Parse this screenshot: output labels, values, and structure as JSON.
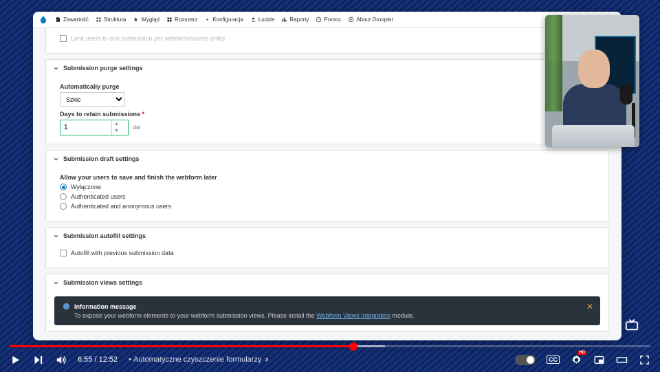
{
  "toolbar": {
    "items": [
      "Zawartość",
      "Struktura",
      "Wygląd",
      "Rozszerz",
      "Konfiguracja",
      "Ludzie",
      "Raporty",
      "Pomoc",
      "About Droopler"
    ]
  },
  "purge": {
    "heading": "Submission purge settings",
    "auto_label": "Automatically purge",
    "auto_value": "Szkic",
    "days_label": "Days to retain submissions",
    "days_value": "1",
    "days_suffix": "dni"
  },
  "draft": {
    "heading": "Submission draft settings",
    "allow_label": "Allow your users to save and finish the webform later",
    "options": [
      "Wyłączone",
      "Authenticated users",
      "Authenticated and anonymous users"
    ],
    "selected": 0
  },
  "autofill": {
    "heading": "Submission autofill settings",
    "check_label": "Autofill with previous submission data"
  },
  "views": {
    "heading": "Submission views settings",
    "info_title": "Information message",
    "info_text_1": "To expose your webform elements to your webform submission views. Please install the ",
    "info_link": "Webform Views Integration",
    "info_text_2": " module."
  },
  "player": {
    "current": "6:55",
    "duration": "12:52",
    "chapter": "Automatyczne czyszczenie formularzy",
    "cc": "CC",
    "hd": "HD"
  }
}
